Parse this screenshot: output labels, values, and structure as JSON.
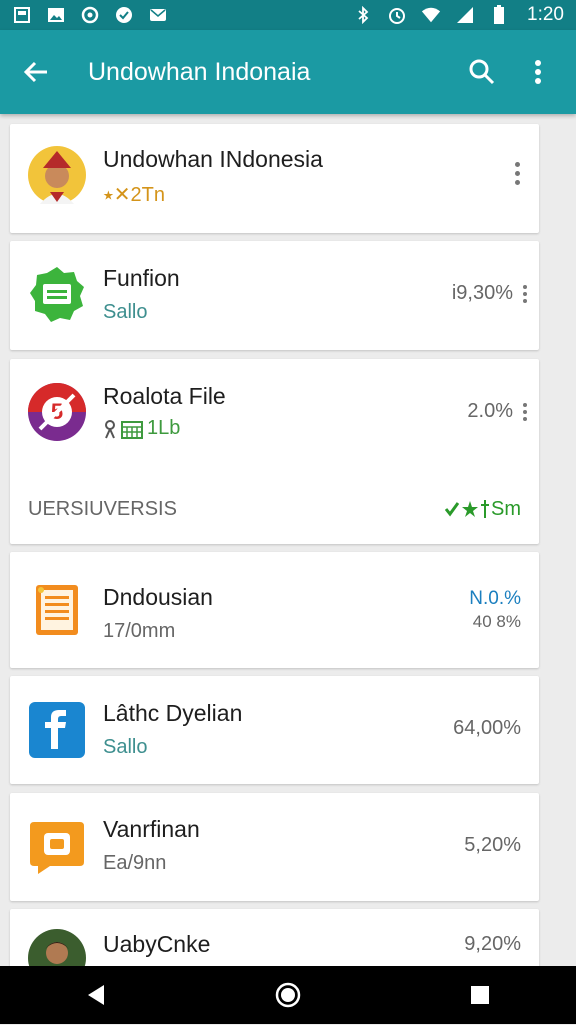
{
  "status_bar": {
    "time": "1:20",
    "left_icons": [
      "notification-icon",
      "image-icon",
      "sync-icon",
      "chat-icon",
      "mail-icon"
    ],
    "right_icons": [
      "bluetooth-icon",
      "alarm-icon",
      "wifi-icon",
      "signal-icon",
      "battery-icon"
    ]
  },
  "app_bar": {
    "title": "Undowhan Indonaia",
    "background": "#1b9aa3",
    "status_background": "#127f86"
  },
  "items": [
    {
      "name": "Undowhan INdonesia",
      "subtitle": "⭑✕2Tn",
      "subtitle_color": "#d4941a",
      "right": "",
      "icon": "person-avatar",
      "has_menu": true
    },
    {
      "name": "Funfion",
      "subtitle": "Sallo",
      "subtitle_color": "#3e8f8f",
      "right": "i9,30%",
      "icon": "green-message-app-icon"
    },
    {
      "name": "Roalota File",
      "subtitle": "1Lb",
      "subtitle_color": "#3e9a3e",
      "right": "2.0%",
      "icon": "red-purple-app-icon"
    },
    {
      "name": "Dndousian",
      "subtitle": "17/0mm",
      "subtitle_color": "#666666",
      "right": "N.0.%",
      "right2": "40 8%",
      "right_color": "#1b7fbf",
      "icon": "orange-document-icon"
    },
    {
      "name": "Lâthc Dyelian",
      "subtitle": "Sallo",
      "subtitle_color": "#3e8f8f",
      "right": "64,00%",
      "icon": "blue-f-app-icon"
    },
    {
      "name": "Vanrfinan",
      "subtitle": "Ea/9nn",
      "subtitle_color": "#666666",
      "right": "5,20%",
      "icon": "orange-chat-icon"
    },
    {
      "name": "UabyCnke",
      "subtitle": "",
      "subtitle_color": "#666666",
      "right": "9,20%",
      "icon": "person-avatar-2"
    }
  ],
  "section": {
    "label": "UERSIUVERSIS",
    "right": "Sm",
    "right_color": "#2a9a2a"
  }
}
